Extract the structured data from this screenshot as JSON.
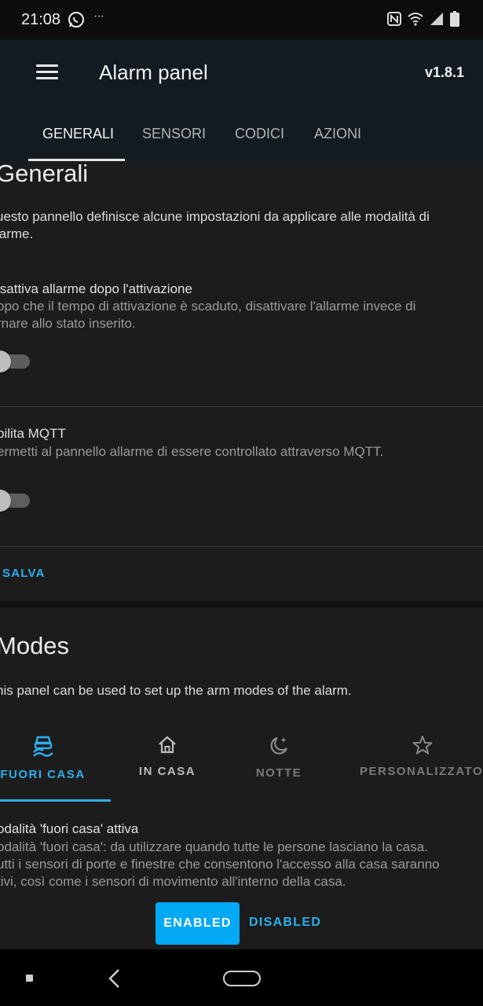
{
  "status_bar": {
    "time": "21:08",
    "more": "···"
  },
  "app_bar": {
    "title": "Alarm panel",
    "version": "v1.8.1"
  },
  "tabs": [
    {
      "label": "GENERALI",
      "active": true
    },
    {
      "label": "SENSORI",
      "active": false
    },
    {
      "label": "CODICI",
      "active": false
    },
    {
      "label": "AZIONI",
      "active": false
    }
  ],
  "general": {
    "title": "Generali",
    "description_line1": "uesto pannello definisce alcune impostazioni da applicare alle modalità di",
    "description_line2": "larme.",
    "disarm_setting": {
      "title": "isattiva allarme dopo l'attivazione",
      "desc_line1": "opo che il tempo di attivazione è scaduto, disattivare l'allarme invece di",
      "desc_line2": "rnare allo stato inserito.",
      "enabled": false
    },
    "mqtt_setting": {
      "title": "bilita MQTT",
      "desc_line1": "ermetti al pannello allarme di essere controllato attraverso MQTT.",
      "enabled": false
    },
    "save_label": "SALVA"
  },
  "modes": {
    "title": "Modes",
    "description": "his panel can be used to set up the arm modes of the alarm.",
    "tabs": [
      {
        "label": "FUORI CASA",
        "icon": "car-shield-icon",
        "active": true
      },
      {
        "label": "IN CASA",
        "icon": "home-icon",
        "active": false
      },
      {
        "label": "NOTTE",
        "icon": "moon-star-icon",
        "active": false
      },
      {
        "label": "PERSONALIZZATO",
        "icon": "star-icon",
        "active": false
      }
    ],
    "active_mode": {
      "title": "odalità 'fuori casa' attiva",
      "desc_line1": "odalità 'fuori casa': da utilizzare quando tutte le persone lasciano la casa.",
      "desc_line2": "utti i sensori di porte e finestre che consentono l'accesso alla casa saranno",
      "desc_line3": "tivi, così come i sensori di movimento all'interno della casa."
    },
    "enabled_label": "ENABLED",
    "disabled_label": "DISABLED"
  },
  "colors": {
    "accent": "#03a9f4",
    "app_bar": "#111b21",
    "background": "#1c1c1c"
  }
}
